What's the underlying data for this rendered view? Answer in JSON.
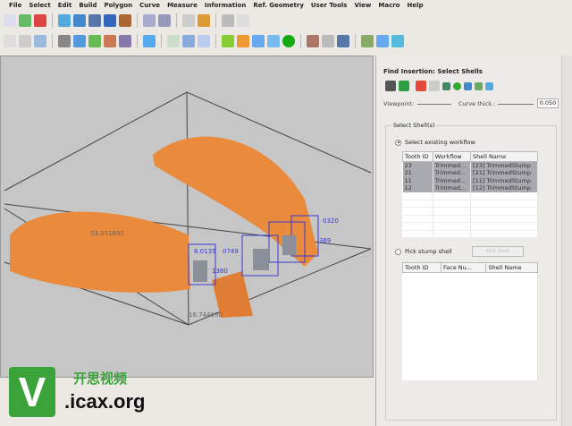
{
  "menu": [
    "File",
    "Select",
    "Edit",
    "Build",
    "Polygon",
    "Curve",
    "Measure",
    "Information",
    "Ref. Geometry",
    "User Tools",
    "View",
    "Macro",
    "Help"
  ],
  "colors": {
    "accent": "#2f9e44",
    "model": "#e98a3c",
    "bbox": "#3a3ad0"
  },
  "viewport": {
    "measurements": [
      "53.551695",
      "16.744690",
      "6.0135",
      "0749",
      "1380",
      "0320",
      "369"
    ]
  },
  "panel": {
    "title": "Find Insertion: Select Shells",
    "viewpoint_label": "Viewpoint:",
    "curve_label": "Curve thick.:",
    "curve_value": "0.050",
    "group_label": "Select Shell(s)",
    "radio_existing": "Select existing workflow",
    "table1": {
      "headers": [
        "Tooth ID",
        "Workflow",
        "Shell Name"
      ],
      "rows": [
        [
          "23",
          "Trimmed...",
          "[23] TrimmedStump"
        ],
        [
          "21",
          "Trimmed...",
          "[21] TrimmedStump"
        ],
        [
          "11",
          "Trimmed...",
          "[11] TrimmedStump"
        ],
        [
          "12",
          "Trimmed...",
          "[12] TrimmedStump"
        ]
      ]
    },
    "radio_pick": "Pick stump shell",
    "pick_button": "Pick Shell",
    "table2": {
      "headers": [
        "Tooth ID",
        "Face Nu...",
        "Shell Name"
      ]
    }
  },
  "watermark": {
    "letter": "V",
    "cn": "开思视频",
    ".org": ".icax.org"
  }
}
